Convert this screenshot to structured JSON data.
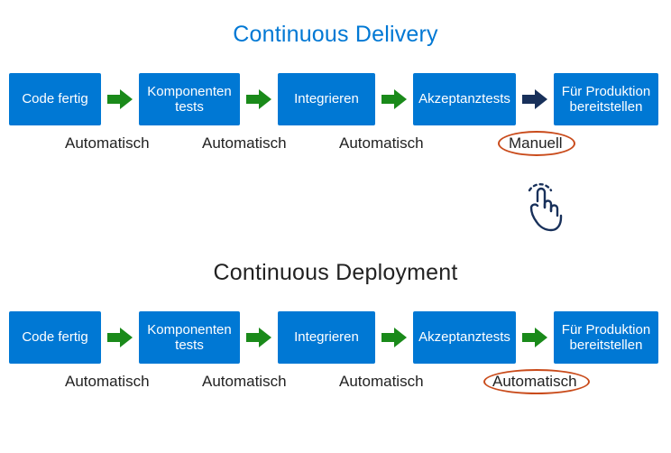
{
  "delivery": {
    "title": "Continuous Delivery",
    "steps": {
      "s1": "Code fertig",
      "s2": "Komponenten\ntests",
      "s3": "Integrieren",
      "s4": "Akzeptanztests",
      "s5": "Für Produktion\nbereitstellen"
    },
    "arrows": {
      "a1": "auto",
      "a2": "auto",
      "a3": "auto",
      "a4": "manual"
    },
    "labels": {
      "l1": "Automatisch",
      "l2": "Automatisch",
      "l3": "Automatisch",
      "l4": "Manuell"
    }
  },
  "deploy": {
    "title": "Continuous Deployment",
    "steps": {
      "s1": "Code fertig",
      "s2": "Komponenten\ntests",
      "s3": "Integrieren",
      "s4": "Akzeptanztests",
      "s5": "Für Produktion\nbereitstellen"
    },
    "arrows": {
      "a1": "auto",
      "a2": "auto",
      "a3": "auto",
      "a4": "auto"
    },
    "labels": {
      "l1": "Automatisch",
      "l2": "Automatisch",
      "l3": "Automatisch",
      "l4": "Automatisch"
    }
  }
}
